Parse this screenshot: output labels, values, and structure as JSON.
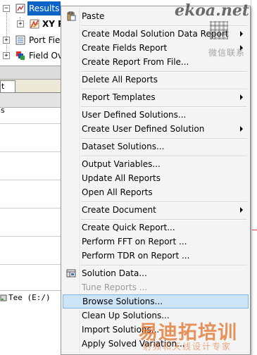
{
  "tree": {
    "items": [
      {
        "label": "Results",
        "selected": true
      },
      {
        "label": "XY P",
        "bold": true
      },
      {
        "label": "Port Fie"
      },
      {
        "label": "Field Ov"
      }
    ],
    "tab_fragment": "t",
    "side_fragment": "s",
    "status_text": "Tee (E:/)"
  },
  "menu": {
    "items": [
      {
        "label": "Paste",
        "icon": "paste-icon"
      },
      {
        "label": "Create Modal Solution Data Report",
        "submenu": true
      },
      {
        "label": "Create Fields Report",
        "submenu": true
      },
      {
        "label": "Create Report From File..."
      },
      {
        "label": "Delete All Reports"
      },
      {
        "label": "Report Templates",
        "submenu": true
      },
      {
        "label": "User Defined Solutions..."
      },
      {
        "label": "Create User Defined Solution",
        "submenu": true
      },
      {
        "label": "Dataset Solutions..."
      },
      {
        "label": "Output Variables..."
      },
      {
        "label": "Update All Reports"
      },
      {
        "label": "Open All Reports"
      },
      {
        "label": "Create Document",
        "submenu": true
      },
      {
        "label": "Create Quick Report..."
      },
      {
        "label": "Perform FFT on Report ..."
      },
      {
        "label": "Perform TDR on Report ..."
      },
      {
        "label": "Solution Data...",
        "icon": "solution-data-icon"
      },
      {
        "label": "Tune Reports ...",
        "disabled": true
      },
      {
        "label": "Browse Solutions...",
        "highlighted": true
      },
      {
        "label": "Clean Up Solutions..."
      },
      {
        "label": "Import Solutions..."
      },
      {
        "label": "Apply Solved Variation..."
      }
    ]
  },
  "watermark": {
    "logo": "ekoa.net",
    "line1": "微信联系",
    "line2": "易迪拓培训",
    "line3": "射频和天线设计专家"
  },
  "colors": {
    "selection": "#0a64c8",
    "menu_highlight": "#cde4f7",
    "menu_highlight_border": "#7eb4ea",
    "menu_background": "#f4f4f4"
  }
}
